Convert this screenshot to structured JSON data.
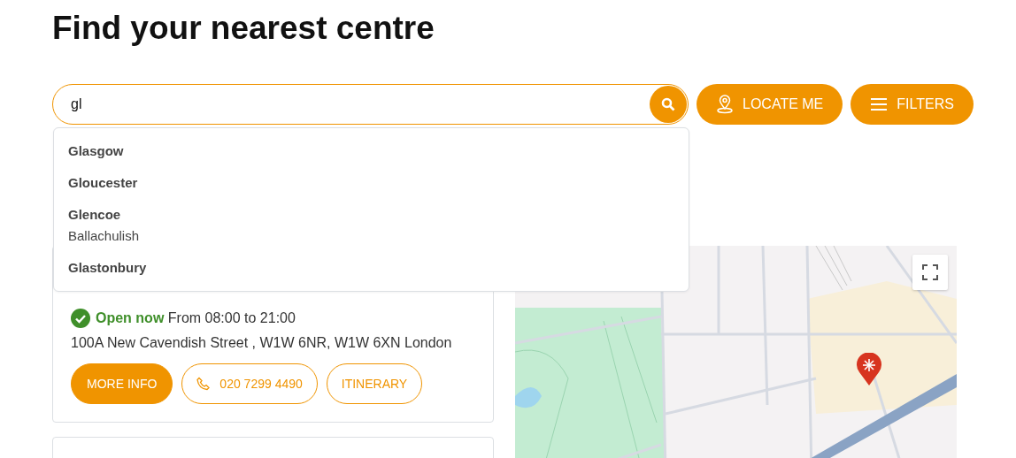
{
  "page": {
    "title": "Find your nearest centre"
  },
  "search": {
    "value": "gl",
    "buttons": [
      {
        "kind": "locate",
        "label": "LOCATE ME"
      },
      {
        "kind": "filters",
        "label": "FILTERS"
      }
    ]
  },
  "suggestions": [
    {
      "name": "Glasgow"
    },
    {
      "name": "Gloucester"
    },
    {
      "name": "Glencoe",
      "detail": "Ballachulish"
    },
    {
      "name": "Glastonbury"
    }
  ],
  "centres": [
    {
      "is_open": true,
      "status": "Open now",
      "hours": "From 08:00 to 21:00",
      "address": "100A New Cavendish Street , W1W 6NR, W1W 6XN London",
      "actions": [
        {
          "kind": "primary",
          "label": "MORE INFO"
        },
        {
          "kind": "phone",
          "label": "020 7299 4490"
        },
        {
          "kind": "outline",
          "label": "ITINERARY"
        }
      ]
    }
  ]
}
